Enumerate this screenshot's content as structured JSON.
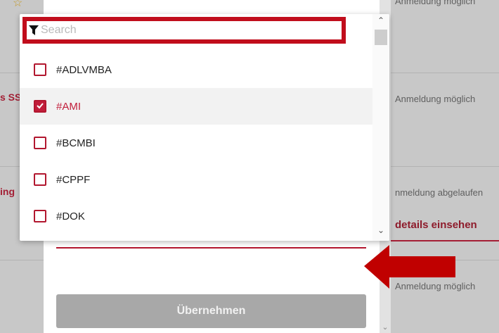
{
  "background": {
    "statuses": [
      "Anmeldung möglich",
      "Anmeldung möglich",
      "nmeldung abgelaufen",
      "Anmeldung möglich"
    ],
    "details_link": "details einsehen",
    "left_texts": [
      "s SS",
      "ing"
    ]
  },
  "dropdown": {
    "search": {
      "placeholder": "Search",
      "value": ""
    },
    "items": [
      {
        "label": "#ADLVMBA",
        "checked": false
      },
      {
        "label": "#AMI",
        "checked": true
      },
      {
        "label": "#BCMBI",
        "checked": false
      },
      {
        "label": "#CPPF",
        "checked": false
      },
      {
        "label": "#DOK",
        "checked": false
      }
    ]
  },
  "modal": {
    "apply_label": "Übernehmen"
  },
  "colors": {
    "accent": "#b3162e",
    "highlight_border": "#c10d1c",
    "arrow": "#c00000"
  }
}
